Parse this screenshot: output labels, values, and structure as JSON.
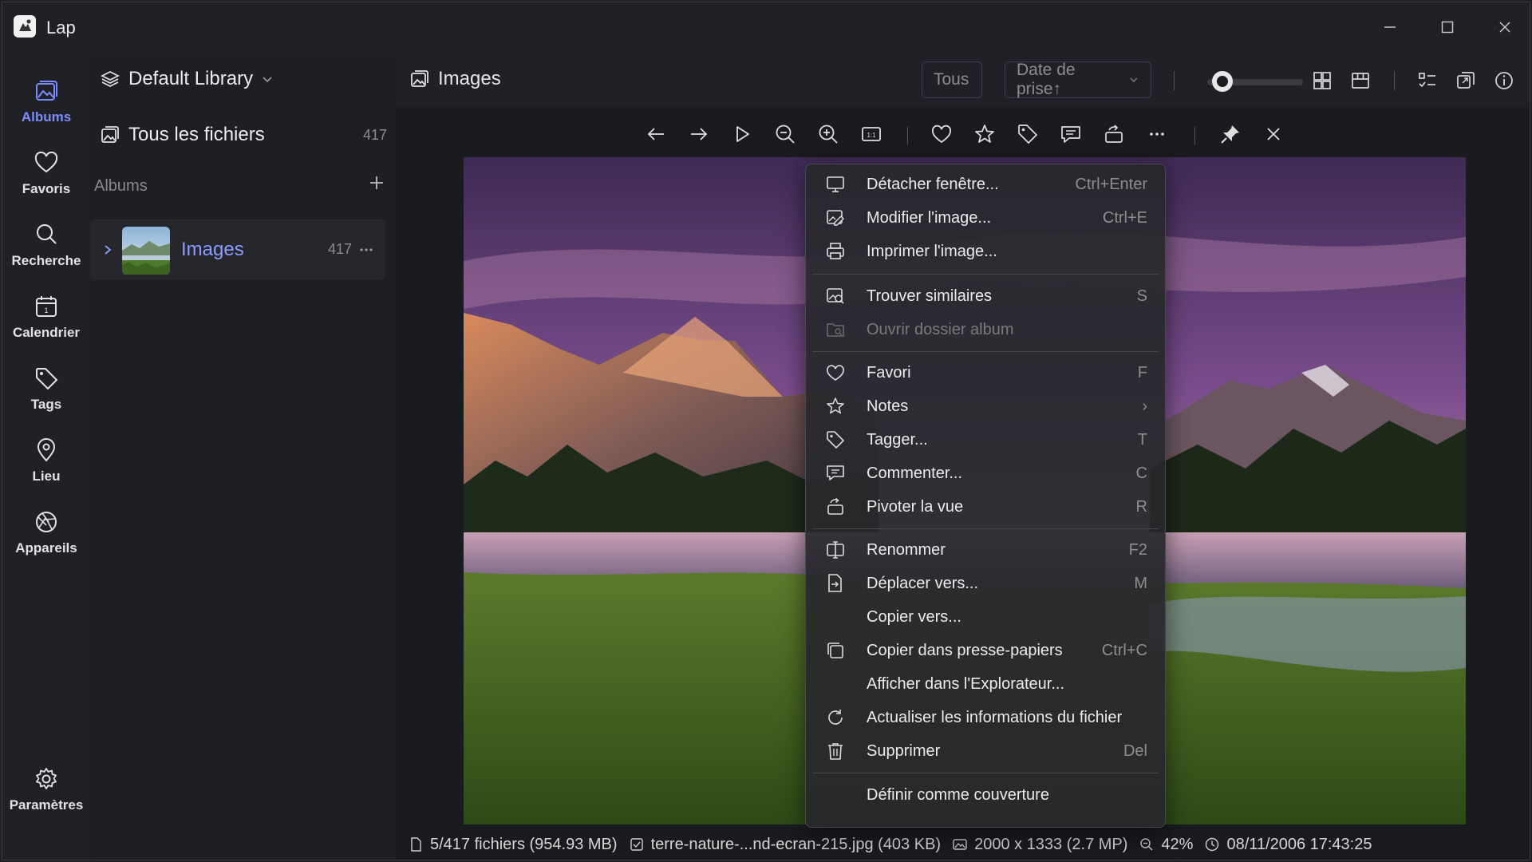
{
  "window": {
    "title": "Lap"
  },
  "rail": {
    "albums": "Albums",
    "favorites": "Favoris",
    "search": "Recherche",
    "calendar": "Calendrier",
    "tags": "Tags",
    "location": "Lieu",
    "devices": "Appareils",
    "settings": "Paramètres"
  },
  "sidebar": {
    "library": "Default Library",
    "all_files": "Tous les fichiers",
    "all_files_count": "417",
    "albums_header": "Albums",
    "album": {
      "name": "Images",
      "count": "417"
    }
  },
  "header": {
    "title": "Images",
    "filter": "Tous",
    "sort": "Date de prise↑"
  },
  "context_menu": [
    {
      "label": "Détacher fenêtre...",
      "shortcut": "Ctrl+Enter",
      "icon": "monitor-icon"
    },
    {
      "label": "Modifier l'image...",
      "shortcut": "Ctrl+E",
      "icon": "edit-image-icon"
    },
    {
      "label": "Imprimer l'image...",
      "shortcut": "",
      "icon": "printer-icon"
    },
    {
      "label": "Trouver similaires",
      "shortcut": "S",
      "icon": "image-search-icon"
    },
    {
      "label": "Ouvrir dossier album",
      "shortcut": "",
      "icon": "folder-search-icon",
      "disabled": true
    },
    {
      "label": "Favori",
      "shortcut": "F",
      "icon": "heart-icon"
    },
    {
      "label": "Notes",
      "shortcut": "›",
      "icon": "star-icon"
    },
    {
      "label": "Tagger...",
      "shortcut": "T",
      "icon": "tag-icon"
    },
    {
      "label": "Commenter...",
      "shortcut": "C",
      "icon": "comment-icon"
    },
    {
      "label": "Pivoter la vue",
      "shortcut": "R",
      "icon": "rotate-icon"
    },
    {
      "label": "Renommer",
      "shortcut": "F2",
      "icon": "rename-icon"
    },
    {
      "label": "Déplacer vers...",
      "shortcut": "M",
      "icon": "move-file-icon"
    },
    {
      "label": "Copier vers...",
      "shortcut": "",
      "icon": ""
    },
    {
      "label": "Copier dans presse-papiers",
      "shortcut": "Ctrl+C",
      "icon": "copy-icon"
    },
    {
      "label": "Afficher dans l'Explorateur...",
      "shortcut": "",
      "icon": ""
    },
    {
      "label": "Actualiser les informations du fichier",
      "shortcut": "",
      "icon": "refresh-icon"
    },
    {
      "label": "Supprimer",
      "shortcut": "Del",
      "icon": "trash-icon"
    },
    {
      "label": "Définir comme couverture",
      "shortcut": "",
      "icon": ""
    }
  ],
  "status": {
    "files": "5/417 fichiers (954.93 MB)",
    "filename": "terre-nature-...nd-ecran-215.jpg (403 KB)",
    "dimensions": "2000 x 1333 (2.7 MP)",
    "zoom": "42%",
    "date": "08/11/2006 17:43:25"
  },
  "colors": {
    "accent": "#8d9cff",
    "background": "#202126",
    "menu": "#28282c"
  }
}
